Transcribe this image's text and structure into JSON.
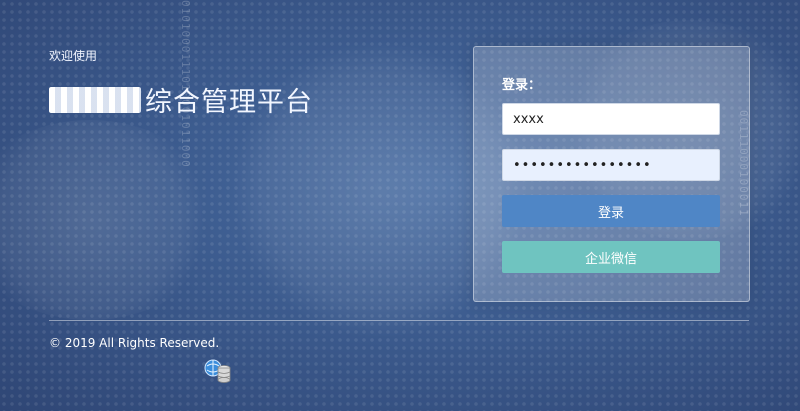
{
  "header": {
    "welcome": "欢迎使用",
    "platform_suffix": "综合管理平台"
  },
  "background": {
    "binary_1": "0101000111010001011000",
    "binary_2": "00111000100011"
  },
  "login": {
    "title": "登录：",
    "username_value": "xxxx",
    "password_value": "••••••••••••••••",
    "login_button": "登录",
    "wechat_button": "企业微信"
  },
  "footer": {
    "copyright": "© 2019 All Rights Reserved."
  },
  "colors": {
    "login_button": "#4f86c6",
    "wechat_button": "#6fc4c0",
    "background": "#3c5b8e"
  }
}
